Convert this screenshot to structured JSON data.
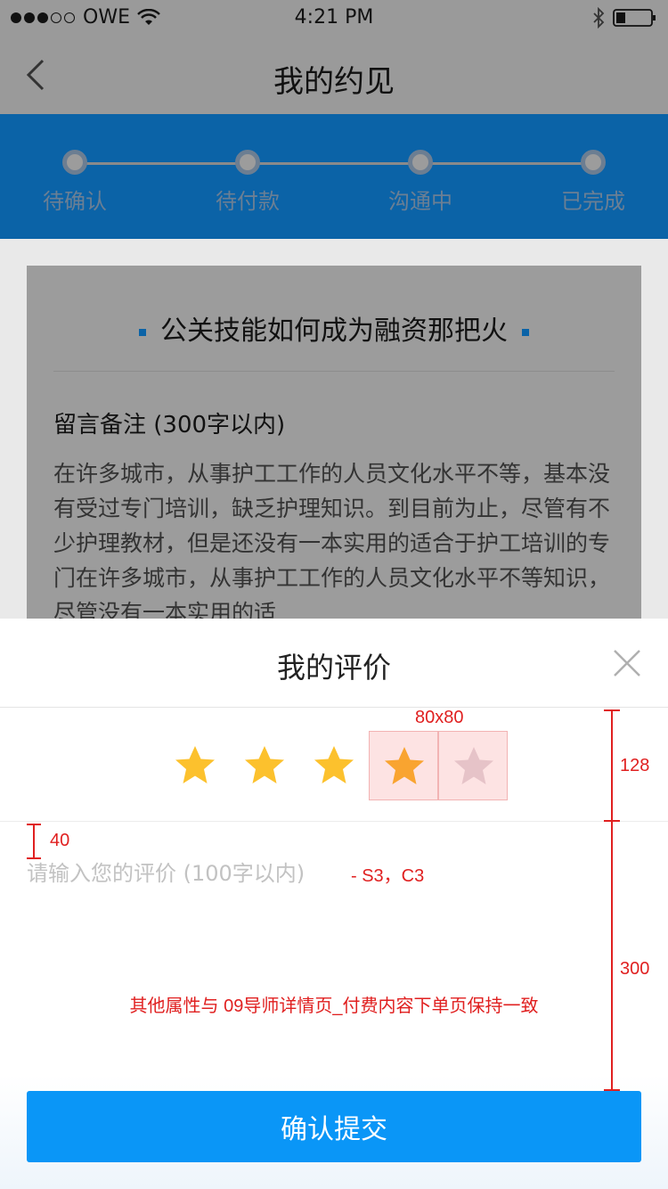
{
  "status_bar": {
    "carrier": "OWE",
    "time": "4:21 PM"
  },
  "nav": {
    "title": "我的约见"
  },
  "progress": {
    "steps": [
      "待确认",
      "待付款",
      "沟通中",
      "已完成"
    ]
  },
  "card": {
    "title": "公关技能如何成为融资那把火",
    "note_heading": "留言备注 (300字以内)",
    "note_body": "在许多城市，从事护工工作的人员文化水平不等，基本没有受过专门培训，缺乏护理知识。到目前为止，尽管有不少护理教材，但是还没有一本实用的适合于护工培训的专门在许多城市，从事护工工作的人员文化水平不等知识，尽管没有一本实用的适"
  },
  "sheet": {
    "title": "我的评价",
    "rating": {
      "value": 4,
      "max": 5
    },
    "comment_placeholder": "请输入您的评价 (100字以内)",
    "submit_label": "确认提交"
  },
  "annotations": {
    "star_size": "80x80",
    "rating_height": "128",
    "placeholder_offset": "40",
    "placeholder_style": "- S3，C3",
    "input_height": "300",
    "note": "其他属性与 09导师详情页_付费内容下单页保持一致"
  },
  "colors": {
    "brand_blue": "#0b63a7",
    "button_blue": "#0a96f7",
    "star_gold": "#fcc12d",
    "annotation_red": "#e02020"
  }
}
